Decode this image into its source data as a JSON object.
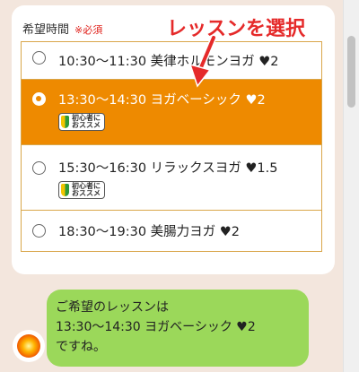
{
  "form": {
    "label": "希望時間",
    "required": "※必須"
  },
  "options": [
    {
      "text": "10:30〜11:30 美律ホルモンヨガ ♥2",
      "selected": false,
      "badge": ""
    },
    {
      "text": "13:30〜14:30 ヨガベーシック ♥2",
      "selected": true,
      "badge": "初心者にオススメ"
    },
    {
      "text": "15:30〜16:30 リラックスヨガ ♥1.5",
      "selected": false,
      "badge": "初心者にオススメ"
    },
    {
      "text": "18:30〜19:30 美腸力ヨガ ♥2",
      "selected": false,
      "badge": ""
    }
  ],
  "badges": {
    "beginner_line1": "初心者に",
    "beginner_line2": "おススメ"
  },
  "annotation": {
    "text": "レッスンを選択",
    "color": "#e52a2a"
  },
  "chat": {
    "line1": "ご希望のレッスンは",
    "line2": "13:30〜14:30 ヨガベーシック ♥2",
    "line3": "ですね。"
  },
  "colors": {
    "selected_bg": "#ee8a00",
    "border": "#d9a64a",
    "bubble": "#9bd85a",
    "page_bg": "#f3e6dd"
  }
}
